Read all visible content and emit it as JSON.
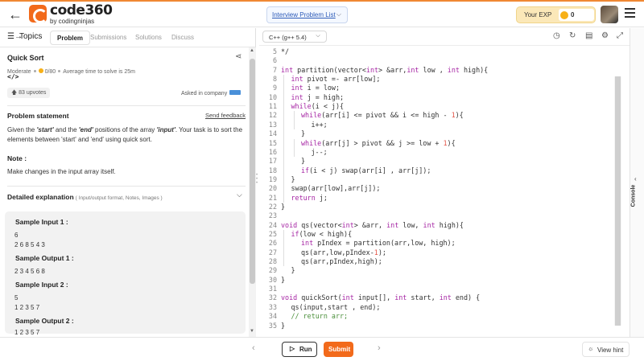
{
  "header": {
    "brand": "code360",
    "brand_sub": "by codingninjas",
    "problem_list": "Interview Problem List",
    "exp_label": "Your EXP",
    "exp_value": "0"
  },
  "tabs": {
    "topics": "Topics",
    "problem": "Problem",
    "submissions": "Submissions",
    "solutions": "Solutions",
    "discuss": "Discuss"
  },
  "problem": {
    "title": "Quick Sort",
    "difficulty": "Moderate",
    "score": "0/80",
    "avg_time": "Average time to solve is 25m",
    "upvotes": "83 upvotes",
    "asked_in": "Asked in company",
    "statement_title": "Problem statement",
    "send_feedback": "Send feedback",
    "statement_parts": [
      "Given the ",
      "'start'",
      " and the ",
      "'end'",
      " positions of the array ",
      "'input'",
      ". Your task is to sort the elements between 'start' and 'end' using quick sort."
    ],
    "note_title": "Note :",
    "note_text": "Make changes in the input array itself.",
    "detailed_title": "Detailed explanation",
    "detailed_sub": "( Input/output format, Notes, Images )"
  },
  "samples": [
    {
      "label": "Sample Input 1 :",
      "lines": [
        "6",
        "2 6 8 5 4 3"
      ]
    },
    {
      "label": "Sample Output 1 :",
      "lines": [
        "2 3 4 5 6 8"
      ]
    },
    {
      "label": "Sample Input 2 :",
      "lines": [
        "5",
        "1 2 3 5 7"
      ]
    },
    {
      "label": "Sample Output 2 :",
      "lines": [
        "1 2 3 5 7"
      ]
    }
  ],
  "editor": {
    "language": "C++ (g++ 5.4)",
    "lines": [
      {
        "n": "5",
        "t": "*/",
        "i": 0
      },
      {
        "n": "6",
        "t": "",
        "i": 0
      },
      {
        "n": "7",
        "t": "int partition(vector<int> &arr,int low , int high){",
        "i": 0
      },
      {
        "n": "8",
        "t": "int pivot =- arr[low];",
        "i": 1
      },
      {
        "n": "9",
        "t": "int i = low;",
        "i": 1
      },
      {
        "n": "10",
        "t": "int j = high;",
        "i": 1
      },
      {
        "n": "11",
        "t": "while(i < j){",
        "i": 1
      },
      {
        "n": "12",
        "t": "while(arr[i] <= pivot && i <= high - 1){",
        "i": 2
      },
      {
        "n": "13",
        "t": "i++;",
        "i": 3
      },
      {
        "n": "14",
        "t": "}",
        "i": 2
      },
      {
        "n": "15",
        "t": "while(arr[j] > pivot && j >= low + 1){",
        "i": 2
      },
      {
        "n": "16",
        "t": "j--;",
        "i": 3
      },
      {
        "n": "17",
        "t": "}",
        "i": 2
      },
      {
        "n": "18",
        "t": "if(i < j) swap(arr[i] , arr[j]);",
        "i": 2
      },
      {
        "n": "19",
        "t": "}",
        "i": 1
      },
      {
        "n": "20",
        "t": "swap(arr[low],arr[j]);",
        "i": 1
      },
      {
        "n": "21",
        "t": "return j;",
        "i": 1
      },
      {
        "n": "22",
        "t": "}",
        "i": 0
      },
      {
        "n": "23",
        "t": "",
        "i": 0
      },
      {
        "n": "24",
        "t": "void qs(vector<int> &arr, int low, int high){",
        "i": 0
      },
      {
        "n": "25",
        "t": "if(low < high){",
        "i": 1
      },
      {
        "n": "26",
        "t": "int pIndex = partition(arr,low, high);",
        "i": 2
      },
      {
        "n": "27",
        "t": "qs(arr,low,pIndex-1);",
        "i": 2
      },
      {
        "n": "28",
        "t": "qs(arr,pIndex,high);",
        "i": 2
      },
      {
        "n": "29",
        "t": "}",
        "i": 1
      },
      {
        "n": "30",
        "t": "}",
        "i": 0
      },
      {
        "n": "31",
        "t": "",
        "i": 0
      },
      {
        "n": "32",
        "t": "void quickSort(int input[], int start, int end) {",
        "i": 0
      },
      {
        "n": "33",
        "t": "qs(input,start , end);",
        "i": 1
      },
      {
        "n": "34",
        "t": "// return arr;",
        "i": 1
      },
      {
        "n": "35",
        "t": "}",
        "i": 0
      }
    ]
  },
  "console_label": "Console",
  "footer": {
    "run": "Run",
    "submit": "Submit",
    "view_hint": "View hint"
  }
}
